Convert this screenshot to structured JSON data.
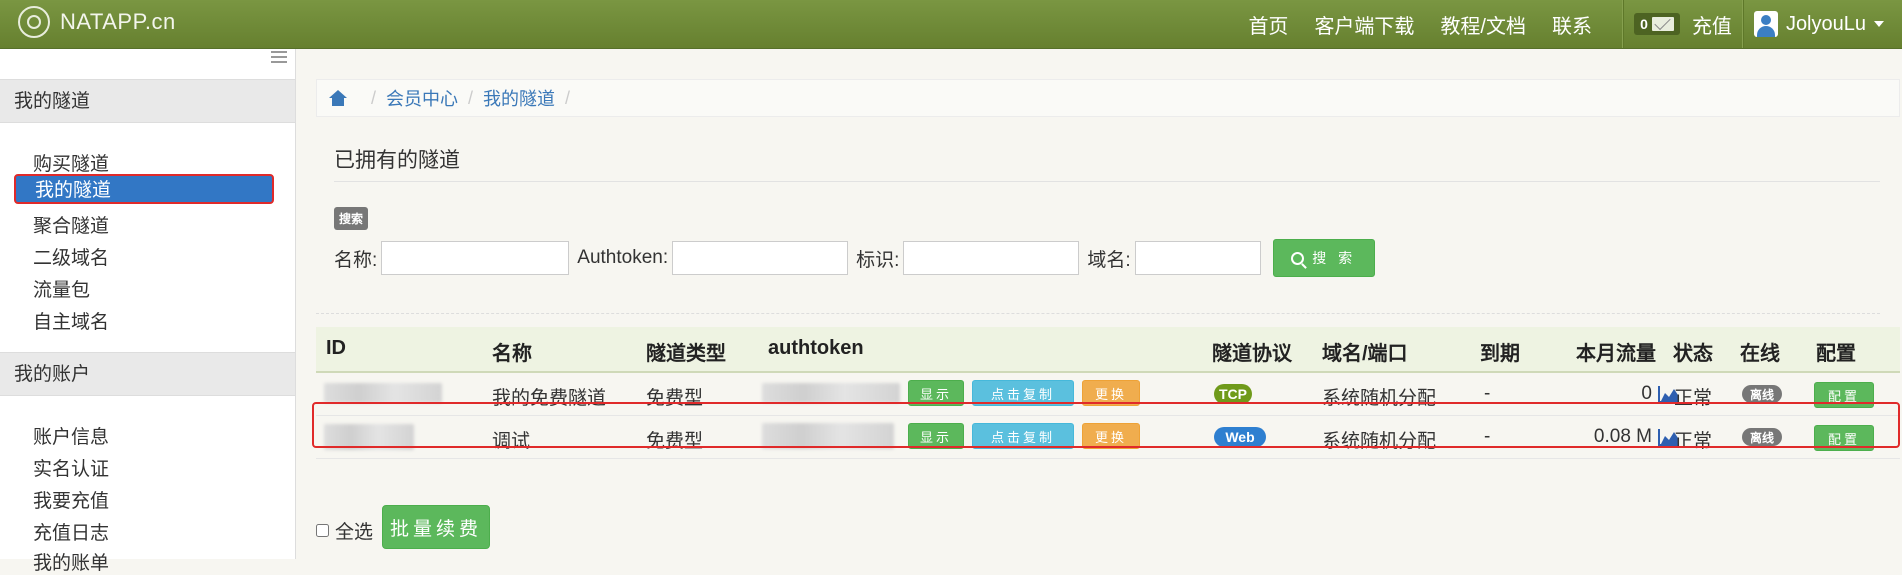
{
  "brand": {
    "name": "NATAPP.cn"
  },
  "nav": {
    "items": [
      "首页",
      "客户端下载",
      "教程/文档",
      "联系"
    ],
    "message_count": "0",
    "recharge": "充值",
    "username": "JolyouLu"
  },
  "sidebar": {
    "section1_title": "我的隧道",
    "section1_items": [
      "购买隧道",
      "我的隧道",
      "聚合隧道",
      "二级域名",
      "流量包",
      "自主域名"
    ],
    "section2_title": "我的账户",
    "section2_items": [
      "账户信息",
      "实名认证",
      "我要充值",
      "充值日志",
      "我的账单"
    ]
  },
  "breadcrumb": {
    "items": [
      "会员中心",
      "我的隧道"
    ]
  },
  "page": {
    "title": "已拥有的隧道"
  },
  "search": {
    "badge": "搜索",
    "label_name": "名称:",
    "label_authtoken": "Authtoken:",
    "label_id": "标识:",
    "label_domain": "域名:",
    "button": "搜 索"
  },
  "table": {
    "headers": [
      "ID",
      "名称",
      "隧道类型",
      "authtoken",
      "隧道协议",
      "域名/端口",
      "到期",
      "本月流量",
      "状态",
      "在线",
      "配置"
    ],
    "buttons": {
      "show": "显示",
      "copy": "点击复制",
      "change": "更换",
      "config": "配置"
    },
    "rows": [
      {
        "name": "我的免费隧道",
        "type": "免费型",
        "protocol": "TCP",
        "domain": "系统随机分配",
        "expire": "-",
        "traffic": "0",
        "status": "正常",
        "online": "离线"
      },
      {
        "name": "调试",
        "type": "免费型",
        "protocol": "Web",
        "domain": "系统随机分配",
        "expire": "-",
        "traffic": "0.08 M",
        "status": "正常",
        "online": "离线"
      }
    ]
  },
  "footer": {
    "select_all": "全选",
    "renew_button": "批量续费"
  },
  "colors": {
    "navbar": "#6f8b3a",
    "active": "#3277c5",
    "green": "#5cb85c",
    "blue": "#5bc0de",
    "orange": "#f0ad4e",
    "highlight": "#e02a2a"
  }
}
